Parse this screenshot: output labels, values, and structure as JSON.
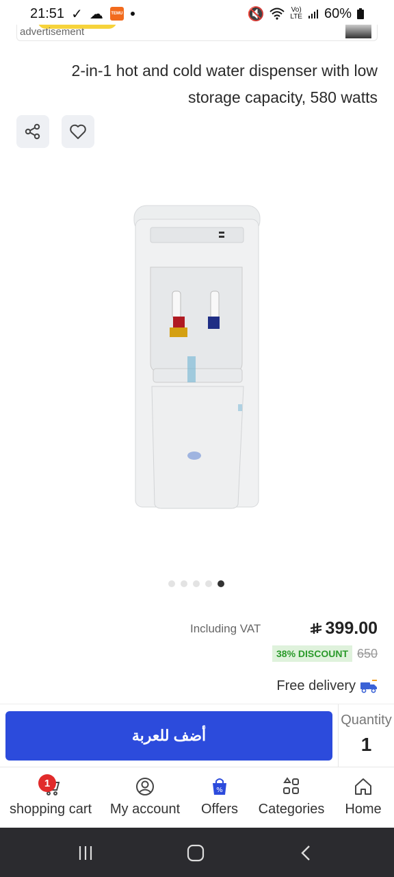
{
  "status": {
    "time": "21:51",
    "battery": "60%",
    "temu_label": "TEMU"
  },
  "ad": {
    "label": "advertisement"
  },
  "product": {
    "title": "2-in-1 hot and cold water dispenser with low storage capacity, 580 watts",
    "gallery": {
      "count": 5,
      "active_index": 4
    },
    "vat_label": "Including VAT",
    "price": "399.00",
    "discount_label": "38% DISCOUNT",
    "old_price": "650",
    "delivery_label": "Free delivery"
  },
  "cart_action": {
    "add_label": "أضف للعربة",
    "quantity_label": "Quantity",
    "quantity_value": "1"
  },
  "bottom_nav": {
    "cart": {
      "label": "shopping cart",
      "badge": "1"
    },
    "account": {
      "label": "My account"
    },
    "offers": {
      "label": "Offers"
    },
    "categories": {
      "label": "Categories"
    },
    "home": {
      "label": "Home"
    }
  },
  "colors": {
    "primary": "#2c4bdc",
    "discount_bg": "#dff2dc",
    "discount_text": "#2a9a2a",
    "badge": "#e12b2b"
  }
}
